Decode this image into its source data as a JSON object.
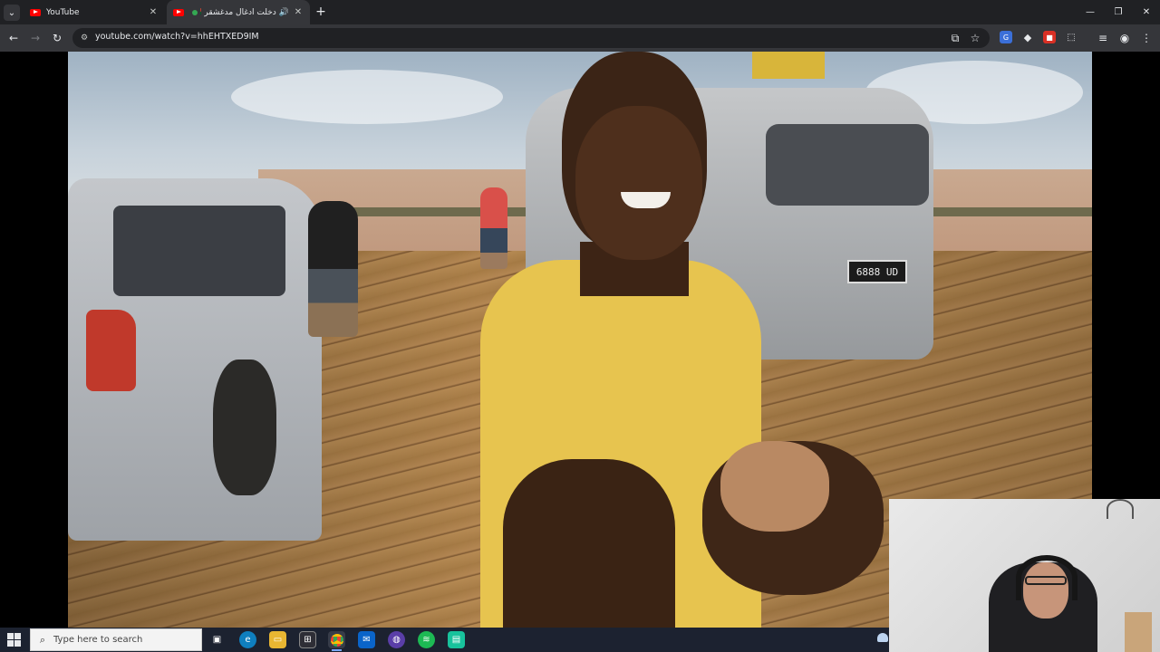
{
  "browser": {
    "tabs": [
      {
        "title": "YouTube",
        "active": false,
        "close_label": "✕"
      },
      {
        "title": "دخلت أدغال مدغشقر 🇲🇬",
        "active": true,
        "close_label": "✕"
      }
    ],
    "tab_search_icon": "chevron-down-icon",
    "new_tab_label": "+",
    "window_controls": {
      "minimize": "—",
      "maximize": "❐",
      "close": "✕"
    },
    "toolbar": {
      "back": "←",
      "forward": "→",
      "reload": "↻",
      "url": "youtube.com/watch?v=hhEHTXED9IM",
      "install_icon": "⧉",
      "bookmark_icon": "☆",
      "menu_icon": "⋮",
      "profile_icon": "◉",
      "media_icon": "≡",
      "extensions_icon": "⬚"
    }
  },
  "video": {
    "license_plate": "6888 UD"
  },
  "taskbar": {
    "search_placeholder": "Type here to search",
    "apps": [
      "task-view",
      "edge",
      "file-explorer",
      "store",
      "chrome",
      "outlook",
      "game-bar",
      "spotify",
      "terminal"
    ]
  },
  "colors": {
    "tab_bar": "#202124",
    "toolbar": "#35363a",
    "youtube_red": "#ff0000",
    "taskbar": "#1c2230"
  }
}
